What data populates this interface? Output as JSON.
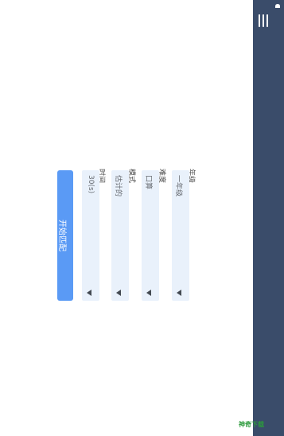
{
  "header": {
    "menu_icon": "menu-icon",
    "status_icon": "bell-icon"
  },
  "form": {
    "grade": {
      "label": "年级",
      "value": "一年级"
    },
    "difficulty": {
      "label": "难度",
      "value": "口算"
    },
    "mode": {
      "label": "模式",
      "value": "估计的"
    },
    "time": {
      "label": "时间",
      "value": "30(s)"
    }
  },
  "actions": {
    "start_label": "开始匹配"
  },
  "watermark": {
    "text": "神奇下载"
  },
  "colors": {
    "sidebar": "#3a4c6a",
    "field_bg": "#e9f1fb",
    "button": "#5a9af5"
  }
}
